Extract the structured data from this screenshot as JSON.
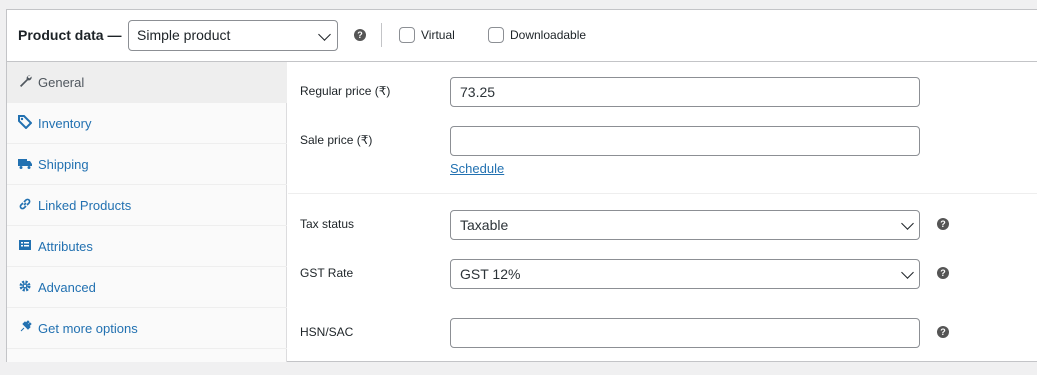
{
  "header": {
    "title": "Product data —",
    "product_type": "Simple product",
    "virtual_label": "Virtual",
    "downloadable_label": "Downloadable"
  },
  "tabs": [
    {
      "label": "General",
      "icon": "wrench-icon",
      "active": true
    },
    {
      "label": "Inventory",
      "icon": "tag-icon",
      "active": false
    },
    {
      "label": "Shipping",
      "icon": "truck-icon",
      "active": false
    },
    {
      "label": "Linked Products",
      "icon": "link-icon",
      "active": false
    },
    {
      "label": "Attributes",
      "icon": "list-icon",
      "active": false
    },
    {
      "label": "Advanced",
      "icon": "gear-icon",
      "active": false
    },
    {
      "label": "Get more options",
      "icon": "plugin-icon",
      "active": false
    }
  ],
  "general": {
    "regular_price_label": "Regular price (₹)",
    "regular_price_value": "73.25",
    "sale_price_label": "Sale price (₹)",
    "sale_price_value": "",
    "schedule_link": "Schedule",
    "tax_status_label": "Tax status",
    "tax_status_value": "Taxable",
    "gst_rate_label": "GST Rate",
    "gst_rate_value": "GST 12%",
    "hsn_label": "HSN/SAC",
    "hsn_value": ""
  },
  "colors": {
    "accent": "#2271b1",
    "border": "#8c8f94"
  }
}
